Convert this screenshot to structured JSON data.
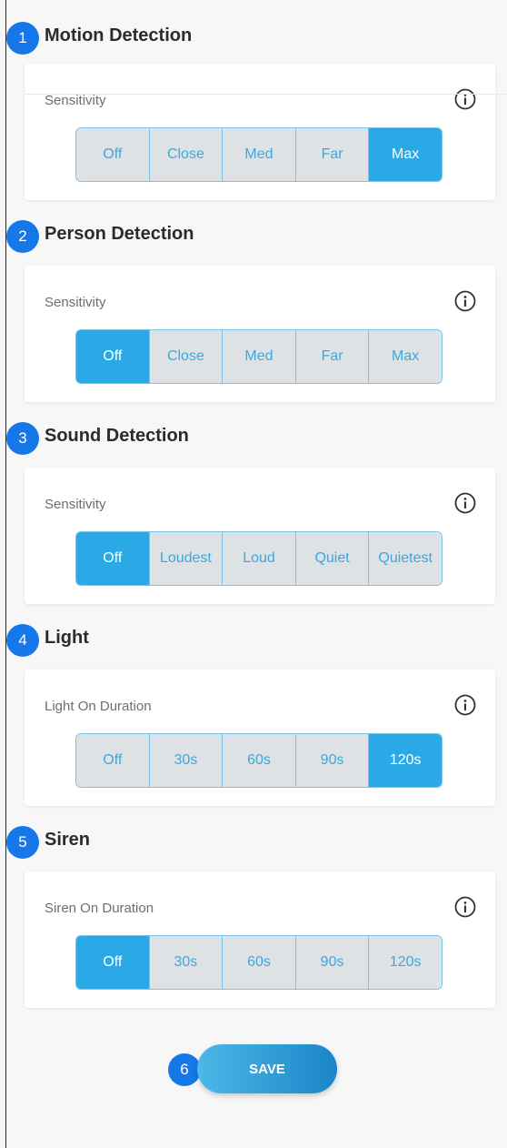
{
  "sections": [
    {
      "badge": "1",
      "title": "Motion Detection",
      "label": "Sensitivity",
      "options": [
        "Off",
        "Close",
        "Med",
        "Far",
        "Max"
      ],
      "selected": "Max"
    },
    {
      "badge": "2",
      "title": "Person Detection",
      "label": "Sensitivity",
      "options": [
        "Off",
        "Close",
        "Med",
        "Far",
        "Max"
      ],
      "selected": "Off"
    },
    {
      "badge": "3",
      "title": "Sound Detection",
      "label": "Sensitivity",
      "options": [
        "Off",
        "Loudest",
        "Loud",
        "Quiet",
        "Quietest"
      ],
      "selected": "Off"
    },
    {
      "badge": "4",
      "title": "Light",
      "label": "Light On Duration",
      "options": [
        "Off",
        "30s",
        "60s",
        "90s",
        "120s"
      ],
      "selected": "120s"
    },
    {
      "badge": "5",
      "title": "Siren",
      "label": "Siren On Duration",
      "options": [
        "Off",
        "30s",
        "60s",
        "90s",
        "120s"
      ],
      "selected": "Off"
    }
  ],
  "save": {
    "badge": "6",
    "label": "SAVE"
  },
  "colors": {
    "accent": "#2aa9e6",
    "badge": "#1677e8",
    "inactive_segment": "#dfe2e4"
  },
  "icons": {
    "info": "info-circle-icon"
  }
}
